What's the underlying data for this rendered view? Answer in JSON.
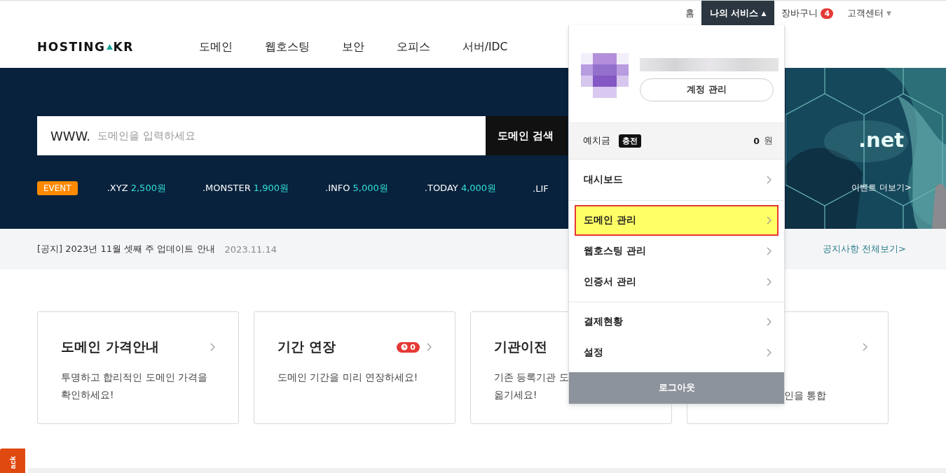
{
  "top_links": [
    {
      "label": "홈",
      "selected": false
    },
    {
      "label": "나의 서비스",
      "caret": "▲",
      "selected": true
    },
    {
      "label": "장바구니",
      "badge": "4",
      "selected": false
    },
    {
      "label": "고객센터",
      "caret": "▼",
      "selected": false
    }
  ],
  "logo": {
    "left": "HOSTING",
    "right": "KR"
  },
  "nav": [
    "도메인",
    "웹호스팅",
    "보안",
    "오피스",
    "서버/IDC"
  ],
  "search": {
    "prefix": "WWW.",
    "placeholder": "도메인을 입력하세요",
    "button": "도메인 검색"
  },
  "event": {
    "badge": "EVENT",
    "items": [
      {
        "tld": ".XYZ",
        "price": "2,500원"
      },
      {
        "tld": ".MONSTER",
        "price": "1,900원"
      },
      {
        "tld": ".INFO",
        "price": "5,000원"
      },
      {
        "tld": ".TODAY",
        "price": "4,000원"
      },
      {
        "tld": ".LIF"
      }
    ]
  },
  "banner": {
    "kind": "picture",
    "title": ".net",
    "link": "이벤트 더보기>"
  },
  "notice": {
    "text": "[공지] 2023년 11월 셋째 주 업데이트 안내",
    "date": "2023.11.14",
    "link": "공지사항 전체보기>"
  },
  "cards": [
    {
      "kind": "full",
      "title": "도메인 가격안내",
      "desc": [
        "투명하고 합리적인 도메인 가격을",
        "확인하세요!"
      ]
    },
    {
      "kind": "full",
      "title": "기간 연장",
      "badge": "0",
      "desc": [
        "도메인 기간을 미리 연장하세요!"
      ]
    },
    {
      "kind": "cut-right",
      "title": "기관이전",
      "desc": [
        "기존 등록기관 도",
        "옮기세요!"
      ]
    },
    {
      "kind": "cut-left",
      "desc": [
        "인을 통합"
      ]
    }
  ],
  "dropdown": {
    "account_button": "계정 관리",
    "deposit": {
      "label": "예치금",
      "charge": "충전",
      "amount": "0",
      "unit": "원"
    },
    "groups": [
      [
        {
          "label": "대시보드",
          "selected": false
        }
      ],
      [
        {
          "label": "도메인 관리",
          "selected": true
        },
        {
          "label": "웹호스팅 관리",
          "selected": false
        },
        {
          "label": "인증서 관리",
          "selected": false
        }
      ],
      [
        {
          "label": "결제현황",
          "selected": false
        },
        {
          "label": "설정",
          "selected": false
        }
      ]
    ],
    "logout": "로그아웃"
  },
  "feedback": "ack"
}
